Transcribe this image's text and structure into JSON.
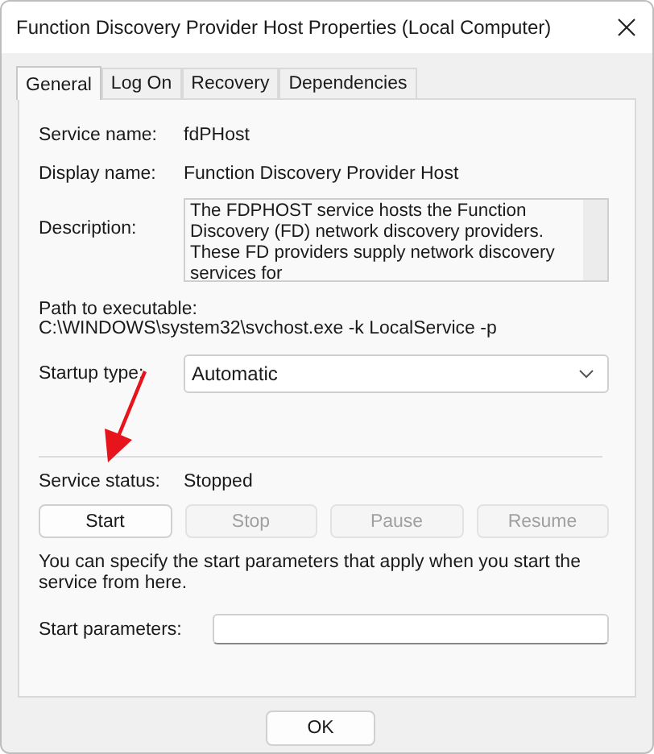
{
  "window": {
    "title": "Function Discovery Provider Host Properties (Local Computer)"
  },
  "tabs": [
    {
      "label": "General",
      "selected": true
    },
    {
      "label": "Log On",
      "selected": false
    },
    {
      "label": "Recovery",
      "selected": false
    },
    {
      "label": "Dependencies",
      "selected": false
    }
  ],
  "service_name": {
    "label": "Service name:",
    "value": "fdPHost"
  },
  "display_name": {
    "label": "Display name:",
    "value": "Function Discovery Provider Host"
  },
  "description": {
    "label": "Description:",
    "value": "The FDPHOST service hosts the Function Discovery (FD) network discovery providers. These FD providers supply network discovery services for"
  },
  "path": {
    "label": "Path to executable:",
    "value": "C:\\WINDOWS\\system32\\svchost.exe -k LocalService -p"
  },
  "startup_type": {
    "label": "Startup type:",
    "value": "Automatic"
  },
  "service_status": {
    "label": "Service status:",
    "value": "Stopped"
  },
  "service_buttons": [
    {
      "label": "Start",
      "disabled": false
    },
    {
      "label": "Stop",
      "disabled": true
    },
    {
      "label": "Pause",
      "disabled": true
    },
    {
      "label": "Resume",
      "disabled": true
    }
  ],
  "hint": "You can specify the start parameters that apply when you start the service from here.",
  "start_parameters": {
    "label": "Start parameters:"
  },
  "dialog_buttons": [
    {
      "label": "OK"
    }
  ]
}
